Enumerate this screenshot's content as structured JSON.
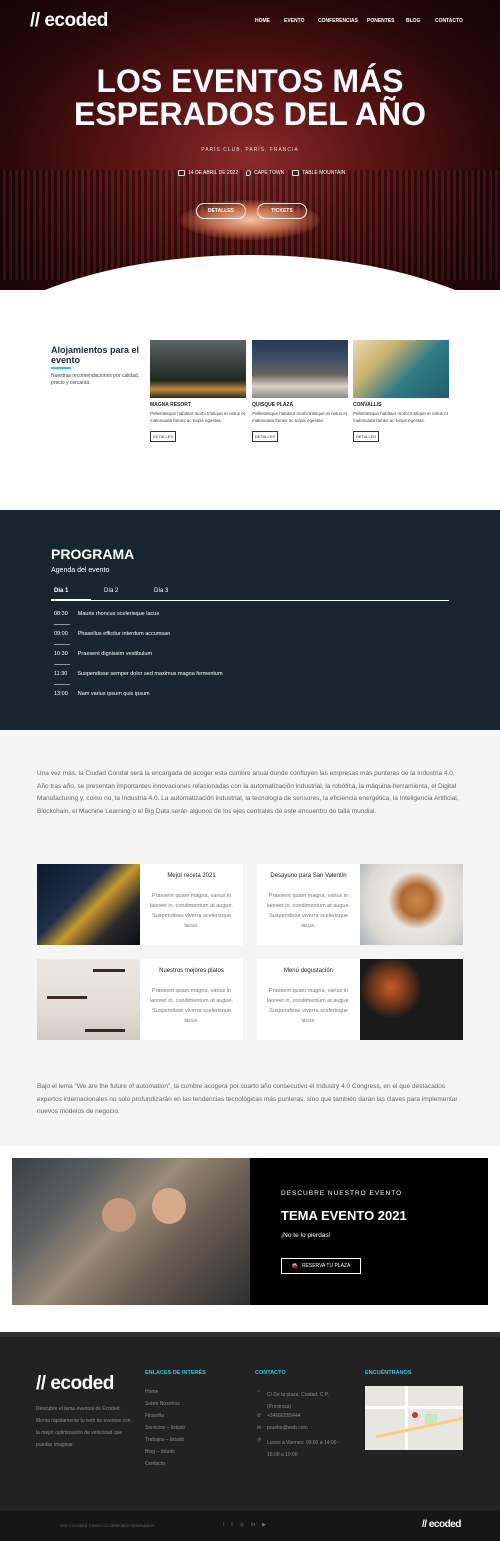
{
  "header": {
    "logo": "// ecoded",
    "nav": [
      "HOME",
      "EVENTO",
      "CONFERENCIAS",
      "PONENTES",
      "BLOG",
      "CONTACTO"
    ]
  },
  "hero": {
    "title_line1": "LOS EVENTOS MÁS",
    "title_line2": "ESPERADOS DEL AÑO",
    "subtitle": "PARÍS CLUB, PARÍS, FRANCIA",
    "date": "14 DE ABRIL DE 2022",
    "place": "CAPE TOWN",
    "venue": "TABLE MOUNTAIN",
    "btn_details": "DETALLES",
    "btn_tickets": "TICKETS"
  },
  "lodging": {
    "title": "Alojamientos para el evento",
    "desc": "Nuestras recomendaciones por calidad, precio y cercanía.",
    "hotels": [
      {
        "name": "MAGNA RESORT",
        "text": "Pellentesque habitant morbi tristique et netus et malesuada fames ac turpis egestas.",
        "btn": "DETALLES"
      },
      {
        "name": "QUISQUE PLAZA",
        "text": "Pellentesque habitant morbi tristique et netus et malesuada fames ac turpis egestas.",
        "btn": "DETALLES"
      },
      {
        "name": "CONVALLIS",
        "text": "Pellentesque habitant morbi tristique et netus et malesuada fames ac turpis egestas.",
        "btn": "DETALLES"
      }
    ]
  },
  "program": {
    "title": "PROGRAMA",
    "subtitle": "Agenda del evento",
    "tabs": [
      "Día 1",
      "Día 2",
      "Día 3"
    ],
    "items": [
      {
        "time": "08:30",
        "text": "Mauris rhoncus scelerisque lacus"
      },
      {
        "time": "09:00",
        "text": "Phasellus efficitur interdum accumsan"
      },
      {
        "time": "10:30",
        "text": "Praesent dignissim vestibulum"
      },
      {
        "time": "11:30",
        "text": "Suspendisse semper dolor sed maximus magna fermentum"
      },
      {
        "time": "13:00",
        "text": "Nam varius ipsum quis ipsum"
      }
    ]
  },
  "intro": "Una vez más, la Ciudad Condal será la encargada de acoger esta cumbre anual donde confluyen las empresas más punteras de la Industria 4.0. Año tras año, se presentan importantes innovaciones relacionadas con la automatización industrial, la robótica, la máquina-herramienta, el Digital Manufacturing y, como no, la Industria 4.0. La automatización industrial, la tecnología de sensores, la eficiencia energética, la Inteligencia Artificial, Blockchain, el Machine Learning o el Big Data serán algunos de los ejes centrales de este encuentro de talla mundial.",
  "cards": [
    {
      "title": "Mejor receta 2021",
      "text": "Praesent quam magna, varius in laoreet in, condimentum at augue. Suspendisse viverra scelerisque lacus."
    },
    {
      "title": "Desayuno para San Valentín",
      "text": "Praesent quam magna, varius in laoreet in, condimentum at augue. Suspendisse viverra scelerisque lacus."
    },
    {
      "title": "Nuestros mejores platos",
      "text": "Praesent quam magna, varius in laoreet in, condimentum at augue. Suspendisse viverra scelerisque lacus."
    },
    {
      "title": "Menú degustación",
      "text": "Praesent quam magna, varius in laoreet in, condimentum at augue. Suspendisse viverra scelerisque lacus."
    }
  ],
  "outro": "Bajo el lema “We are the future of automation”, la cumbre acogerá por cuarto año consecutivo el Industry 4.0 Congress, en el que destacados expertos internacionales no solo profundizarán en las tendencias tecnológicas más punteras, sino que también darán las claves para implementar nuevos modelos de negocio.",
  "tema": {
    "kicker": "DESCUBRE NUESTRO EVENTO",
    "title": "TEMA EVENTO 2021",
    "sub": "¡No te lo pierdas!",
    "btn": "RESERVA TU PLAZA"
  },
  "footer": {
    "logo": "// ecoded",
    "about": "Descubre el tema eventos de Ecoded. Monta rápidamente tu web de eventos con la mejor optimización de velocidad que puedas imaginar.",
    "links_title": "ENLACES DE INTERÉS",
    "links": [
      "Home",
      "Sobre Nosotros",
      "Filosofía",
      "Servicios – listado",
      "Trabajos – listado",
      "Blog – listado",
      "Contacto"
    ],
    "contact_title": "CONTACTO",
    "address": "C/ De la plaza, Ciudad, C.P. (Provincia)",
    "phone": "+34666555444",
    "email": "prueba@web.com",
    "hours": "Lunes a Viernes: 09:00 a 14:00 - 16:00 a 19:00",
    "map_title": "ENCUÉNTRANOS",
    "copyright": "2021 © ECODED TODOS LOS DERECHOS RESERVADOS.",
    "bottom_logo": "// ecoded"
  },
  "colors": {
    "accent": "#35c3dc",
    "dark": "#17262f",
    "footer": "#222222"
  }
}
